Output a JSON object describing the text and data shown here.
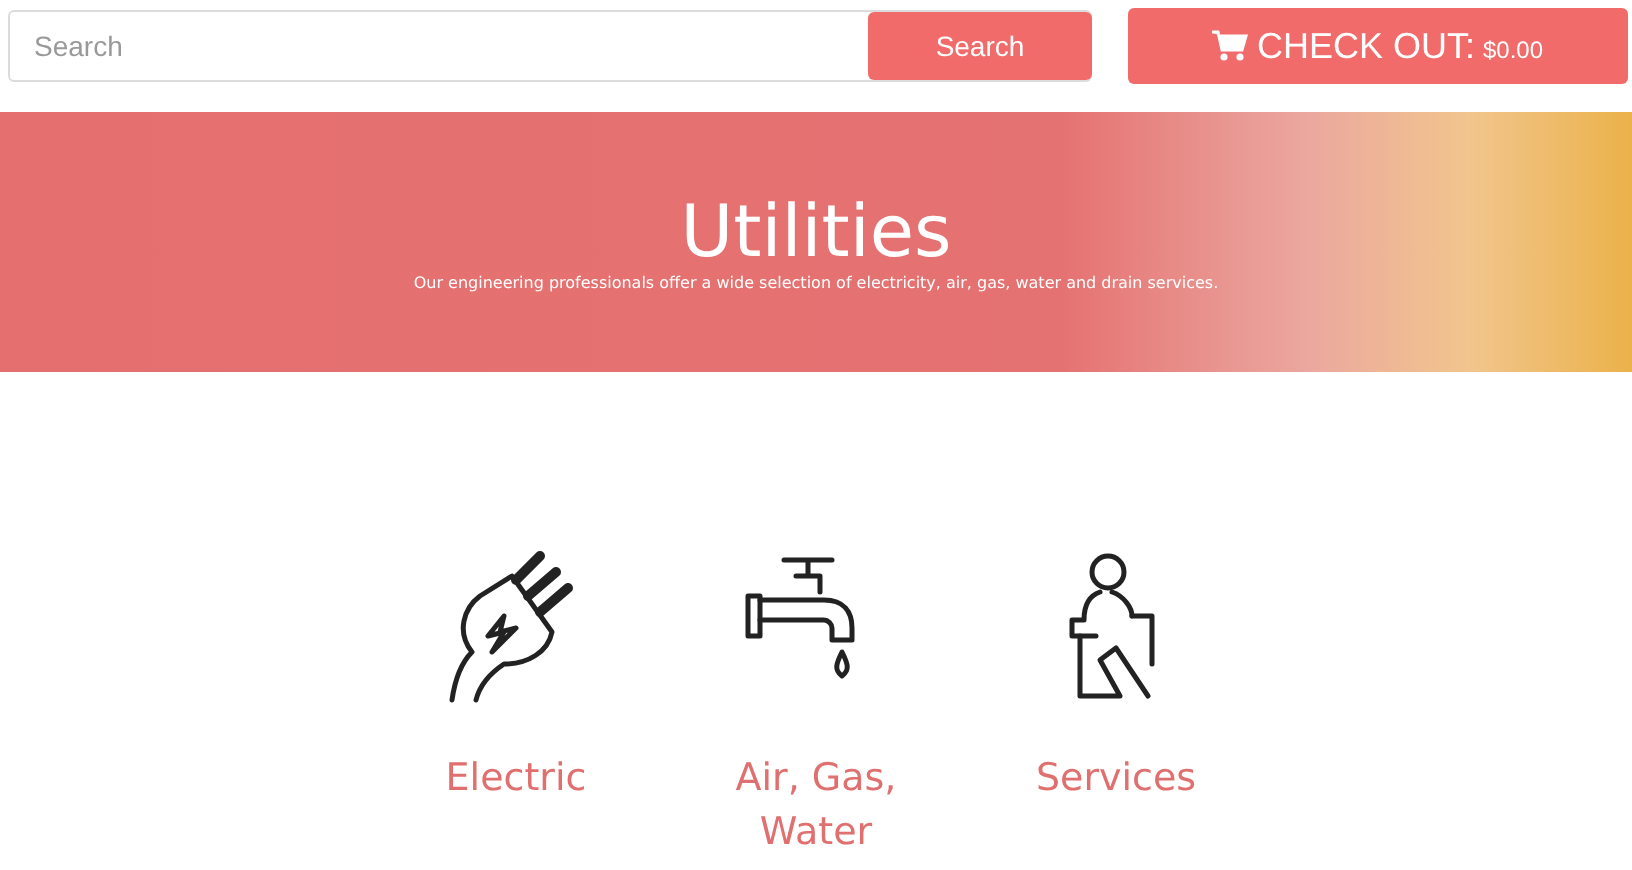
{
  "search": {
    "placeholder": "Search",
    "button": "Search"
  },
  "checkout": {
    "label": "CHECK OUT:",
    "amount": "$0.00"
  },
  "banner": {
    "title": "Utilities",
    "subtitle": "Our engineering professionals offer a wide selection of electricity, air, gas, water and drain services."
  },
  "categories": [
    {
      "kind": "plug",
      "label": "Electric"
    },
    {
      "kind": "tap",
      "label": "Air, Gas, Water"
    },
    {
      "kind": "person",
      "label": "Services"
    }
  ]
}
